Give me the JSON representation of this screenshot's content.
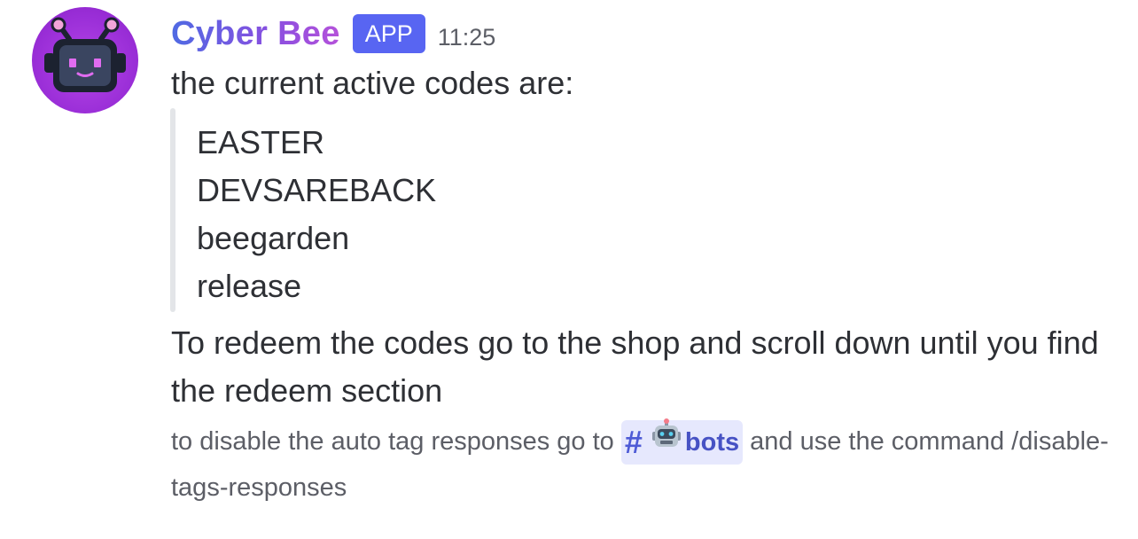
{
  "message": {
    "author": "Cyber Bee",
    "badge": "APP",
    "time": "11:25",
    "intro": "the current active codes are:",
    "codes": [
      "EASTER",
      "DEVSAREBACK",
      "beegarden",
      "release"
    ],
    "redeem_text": "To redeem the codes go to the shop and scroll down until you find the redeem section",
    "note_before": "to disable the auto tag responses go to",
    "channel_mention": "bots",
    "note_after": "and use the command /disable-tags-responses"
  },
  "icons": {
    "avatar": "robot-bee-avatar",
    "channel": "hash-icon",
    "channel_emoji": "robot-emoji-icon"
  },
  "colors": {
    "badge": "#5865f2",
    "mention_bg": "#e6e8fd",
    "mention_text": "#4752c4",
    "avatar_bg": "#9b2fd8"
  }
}
